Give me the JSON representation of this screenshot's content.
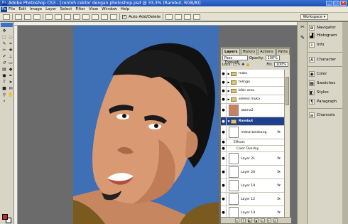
{
  "window": {
    "title": "Adobe Photoshop CS3 - [contoh cektor dengan photoshop.psd @ 33,3% (Rambut, RGB/8)]",
    "logo": "Ps",
    "controls": [
      "_",
      "□",
      "✕"
    ]
  },
  "menu": [
    "File",
    "Edit",
    "Image",
    "Layer",
    "Select",
    "Filter",
    "View",
    "Window",
    "Help"
  ],
  "options_bar": {
    "auto_add_delete_label": "Auto Add/Delete",
    "workspace_label": "Workspace ▾"
  },
  "layers_panel": {
    "tabs": [
      "Layers",
      "History",
      "Actions",
      "Paths"
    ],
    "blend_mode": "Pass Through",
    "opacity_label": "Opacity:",
    "opacity_value": "100%",
    "lock_label": "Lock:",
    "fill_label": "Fill:",
    "fill_value": "100%",
    "layers": [
      {
        "name": "mata",
        "kind": "group"
      },
      {
        "name": "telinga",
        "kind": "group"
      },
      {
        "name": "bibir area",
        "kind": "group"
      },
      {
        "name": "seleksi muka",
        "kind": "group"
      },
      {
        "name": "utama2",
        "kind": "photo"
      },
      {
        "name": "Rambut",
        "kind": "group",
        "selected": true
      },
      {
        "name": "rmbut belakang",
        "kind": "layer",
        "fx": "fx"
      },
      {
        "name": "Effects",
        "kind": "sub"
      },
      {
        "name": "Color Overlay",
        "kind": "sub"
      },
      {
        "name": "Layer 21",
        "kind": "layer",
        "fx": "fx"
      },
      {
        "name": "Layer 20",
        "kind": "layer",
        "fx": "fx"
      },
      {
        "name": "Layer 19",
        "kind": "layer",
        "fx": "fx"
      },
      {
        "name": "Layer 12",
        "kind": "layer",
        "fx": "fx"
      },
      {
        "name": "Layer 14",
        "kind": "layer",
        "fx": "fx"
      }
    ],
    "fx_label": "fx"
  },
  "dock_panels": [
    {
      "label": "Navigator",
      "icon": "navigator-icon"
    },
    {
      "label": "Histogram",
      "icon": "histogram-icon"
    },
    {
      "label": "Info",
      "icon": "info-icon"
    },
    {
      "label": "Character",
      "icon": "character-icon"
    },
    {
      "label": "Color",
      "icon": "color-icon"
    },
    {
      "label": "Swatches",
      "icon": "swatches-icon"
    },
    {
      "label": "Styles",
      "icon": "styles-icon"
    },
    {
      "label": "Paragraph",
      "icon": "paragraph-icon"
    },
    {
      "label": "Channels",
      "icon": "channels-icon"
    }
  ],
  "colors": {
    "canvas_bg": "#3f6fb5",
    "skin": "#d99a73",
    "hair": "#1b1b1b",
    "shirt": "#7a5a1f",
    "foreground": "#c52a2a",
    "background": "#ffffff"
  }
}
